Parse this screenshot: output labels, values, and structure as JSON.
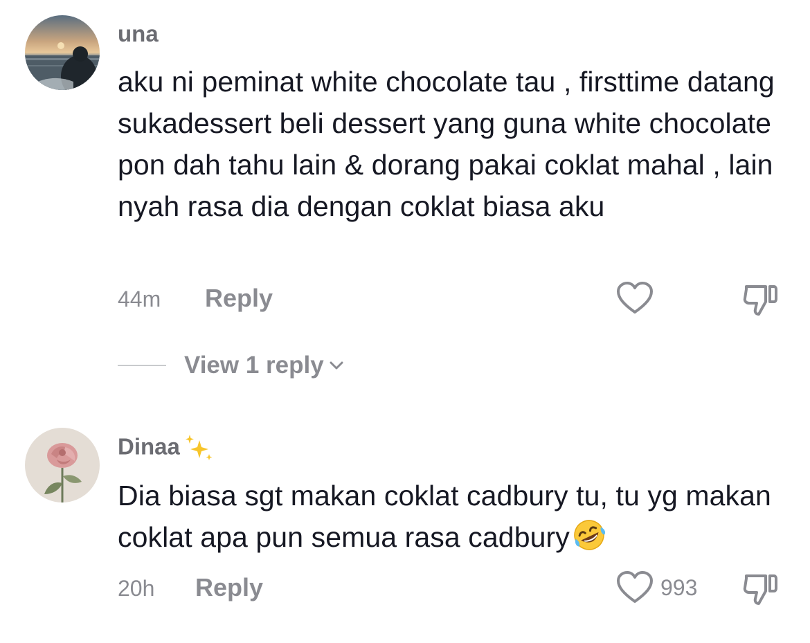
{
  "comments": [
    {
      "username": "una",
      "text": "aku ni peminat white chocolate tau , firsttime datang sukadessert beli dessert yang guna white chocolate pon dah tahu lain & dorang pakai coklat mahal , lain nyah rasa dia dengan coklat biasa aku",
      "time": "44m",
      "reply_label": "Reply",
      "like_count": "",
      "view_replies_label": "View 1 reply",
      "avatar_icon": "sunset-silhouette-avatar"
    },
    {
      "username": "Dinaa",
      "username_emoji": "sparkles-icon",
      "text": "Dia biasa sgt makan coklat cadbury tu, tu yg makan coklat apa pun semua rasa cadbury",
      "text_emoji": "rolling-on-floor-laughing-emoji",
      "time": "20h",
      "reply_label": "Reply",
      "like_count": "993",
      "avatar_icon": "rose-avatar"
    }
  ],
  "colors": {
    "primary_text": "#161823",
    "secondary_text": "#8a8b91",
    "username_text": "#6b6c72"
  }
}
